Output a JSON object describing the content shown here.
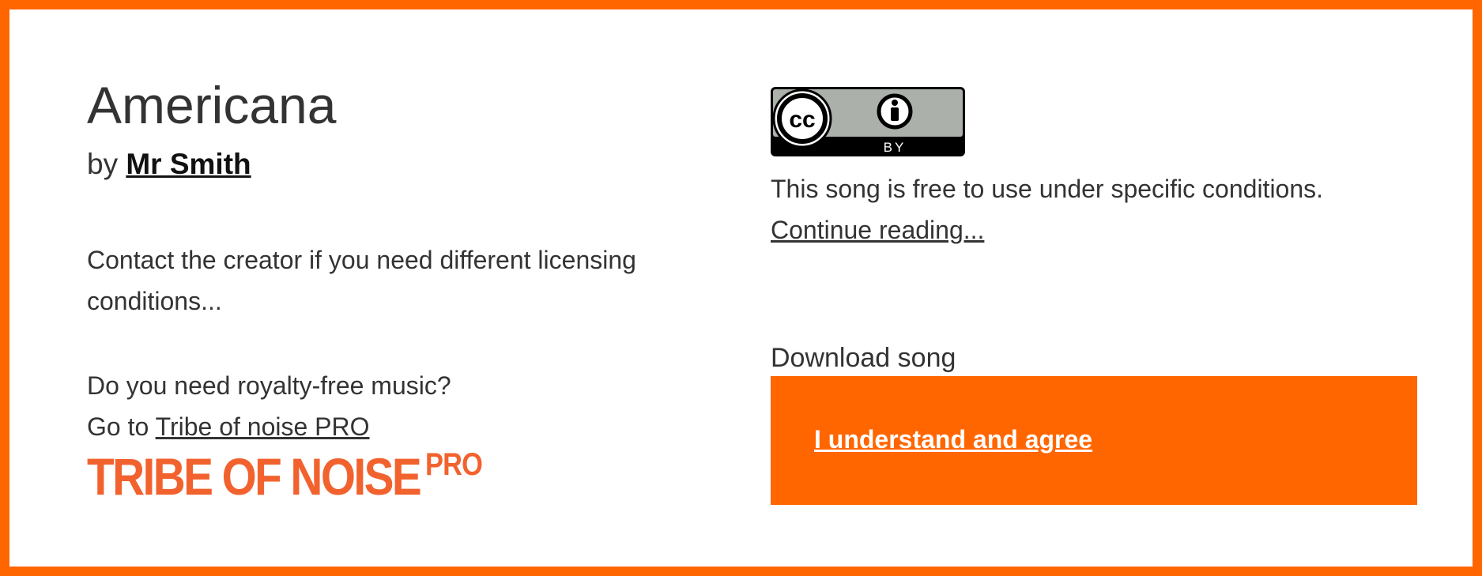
{
  "song": {
    "title": "Americana",
    "by_prefix": "by ",
    "artist": "Mr Smith"
  },
  "contact": {
    "text": "Contact the creator if you need different licensing conditions..."
  },
  "royalty": {
    "question": "Do you need royalty-free music?",
    "go_to": "Go to ",
    "link": "Tribe of noise PRO"
  },
  "logo": {
    "main": "TRIBE OF NOISE",
    "pro": "PRO"
  },
  "license": {
    "badge_cc": "cc",
    "badge_by": "BY",
    "text": "This song is free to use under specific conditions.",
    "continue": "Continue reading..."
  },
  "download": {
    "label": "Download song",
    "agree": "I understand and agree"
  },
  "colors": {
    "accent": "#ff6600",
    "logo": "#f2622e",
    "text": "#333333"
  }
}
